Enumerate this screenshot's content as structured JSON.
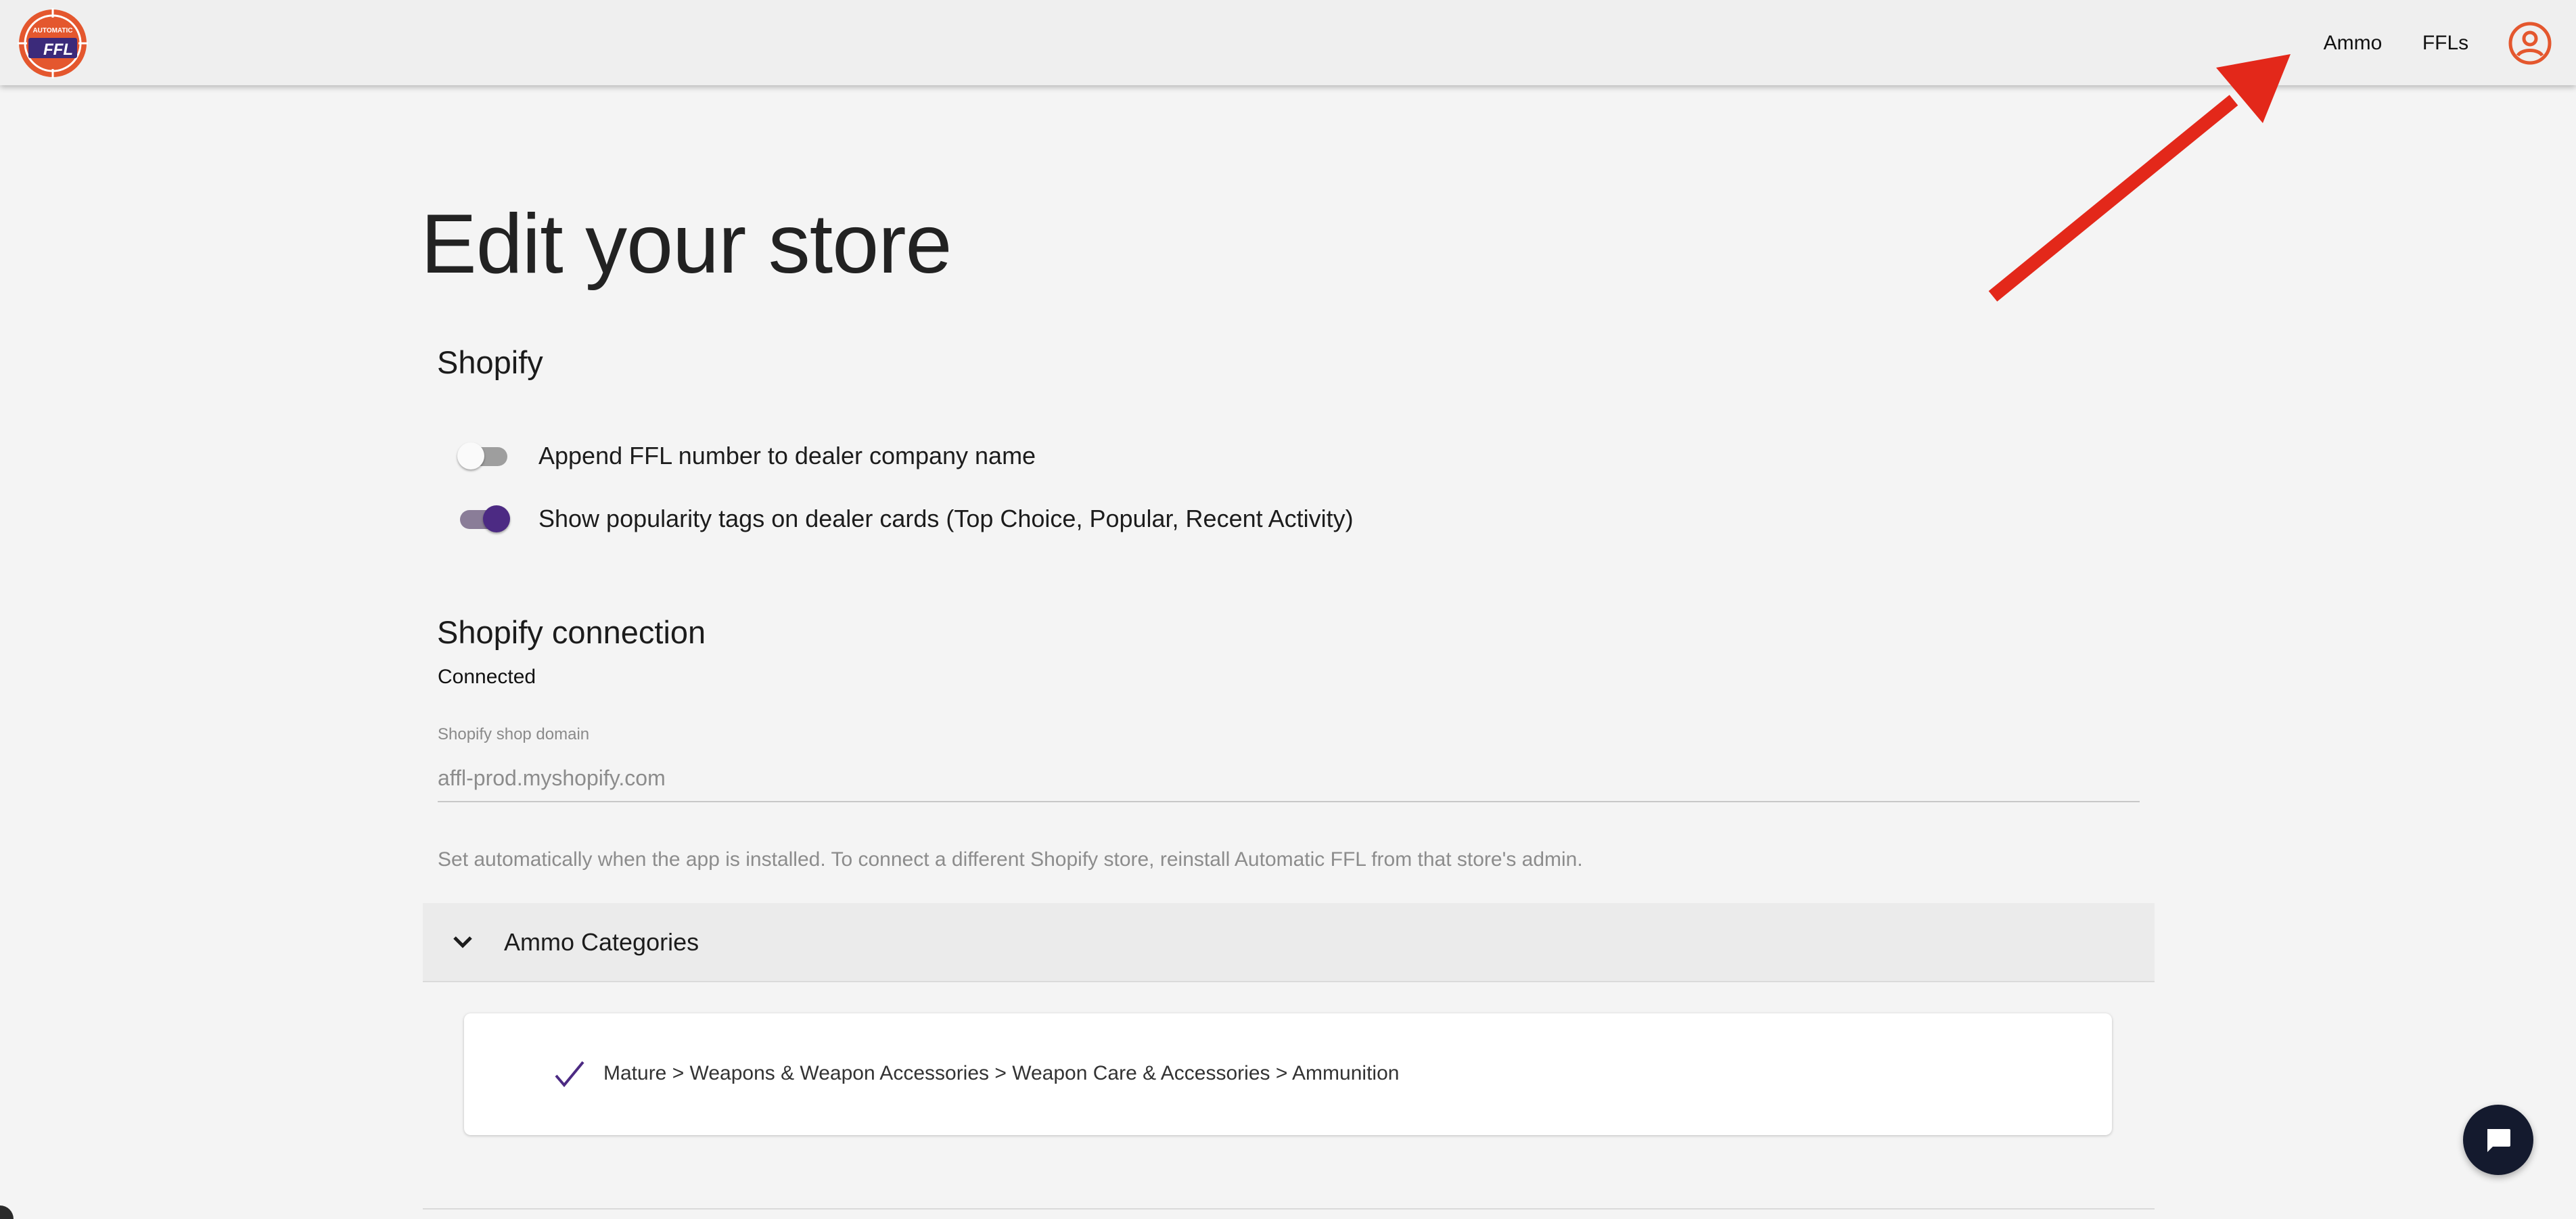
{
  "header": {
    "logo_icon": "automatic-ffl-logo",
    "logo_text_top": "AUTOMATIC",
    "logo_text_main": "FFL",
    "nav": [
      {
        "label": "Ammo"
      },
      {
        "label": "FFLs"
      }
    ],
    "account_icon": "account-circle-icon"
  },
  "annotation": {
    "color": "#e3281a"
  },
  "page": {
    "title": "Edit your store"
  },
  "shopify": {
    "title": "Shopify",
    "toggles": [
      {
        "label": "Append FFL number to dealer company name",
        "on": false
      },
      {
        "label": "Show popularity tags on dealer cards (Top Choice, Popular, Recent Activity)",
        "on": true
      }
    ]
  },
  "connection": {
    "title": "Shopify connection",
    "status": "Connected",
    "field_label": "Shopify shop domain",
    "field_value": "affl-prod.myshopify.com",
    "help": "Set automatically when the app is installed. To connect a different Shopify store, reinstall Automatic FFL from that store's admin."
  },
  "ammo_categories": {
    "title": "Ammo Categories",
    "items": [
      {
        "label": "Mature > Weapons & Weapon Accessories > Weapon Care & Accessories > Ammunition",
        "checked": true
      }
    ]
  },
  "chat": {
    "icon": "chat-icon"
  },
  "colors": {
    "accent": "#4c2a83",
    "brand_orange": "#e4572e",
    "chat_button": "#141a2e"
  }
}
